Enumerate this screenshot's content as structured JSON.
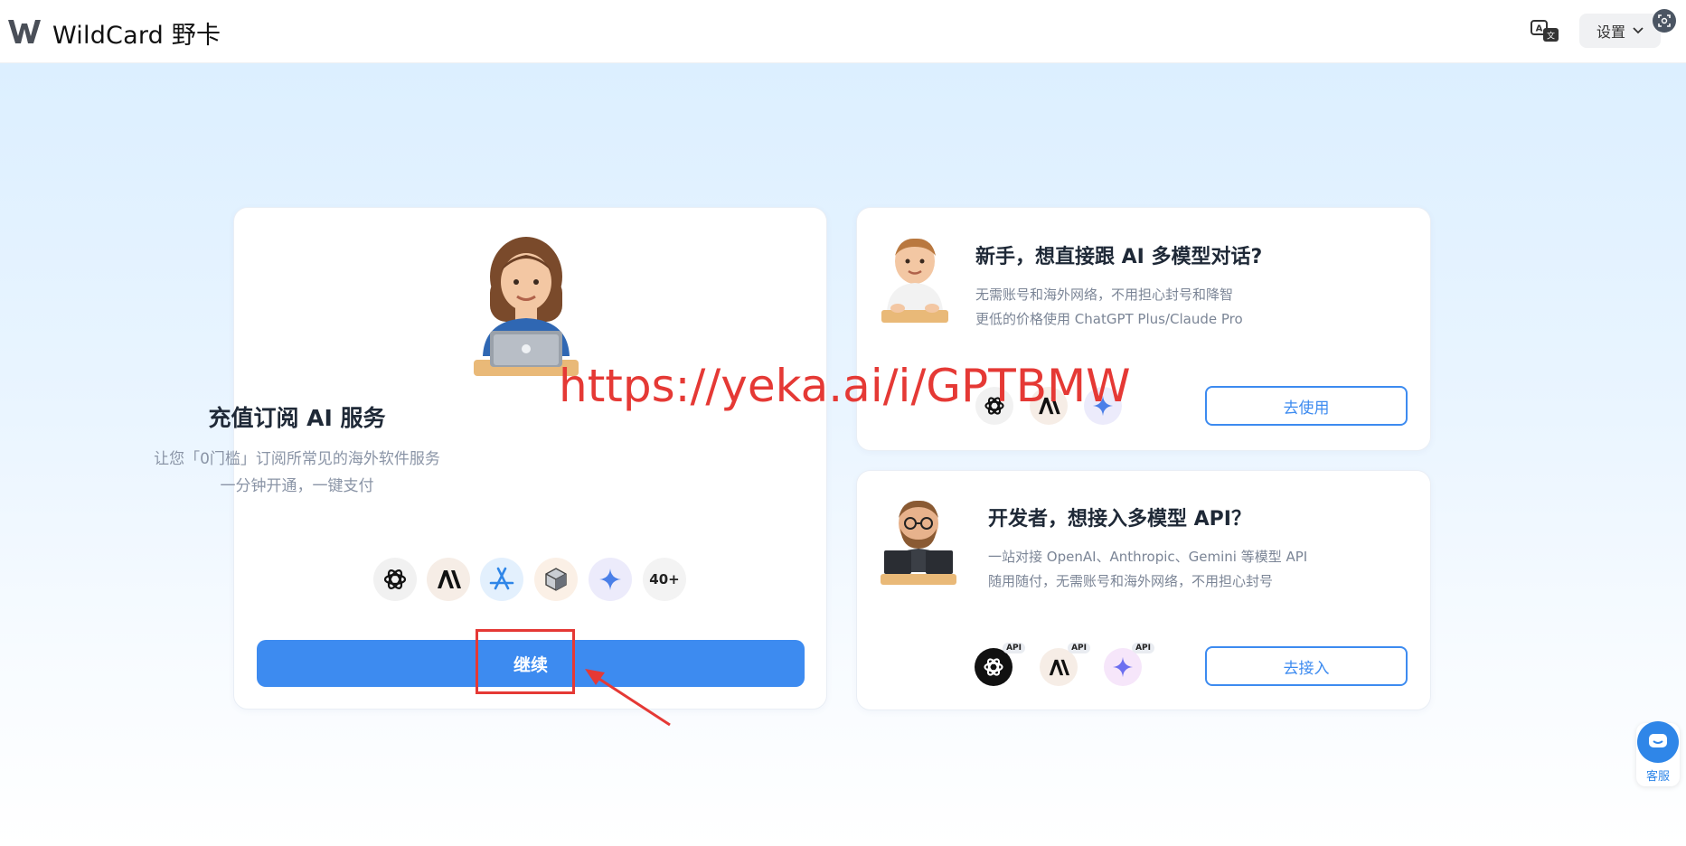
{
  "header": {
    "brand": "WildCard 野卡",
    "settings_label": "设置"
  },
  "main_card": {
    "title": "充值订阅 AI 服务",
    "subtitle_line1": "让您「0门槛」订阅所常见的海外软件服务",
    "subtitle_line2": "一分钟开通，一键支付",
    "services": [
      "openai-icon",
      "anthropic-icon",
      "app-store-icon",
      "box-icon",
      "gemini-icon",
      "40+"
    ],
    "continue_label": "继续"
  },
  "watermark": "https://yeka.ai/i/GPTBMW",
  "beginner_card": {
    "title": "新手，想直接跟 AI 多模型对话?",
    "desc_line1": "无需账号和海外网络，不用担心封号和降智",
    "desc_line2": "更低的价格使用 ChatGPT Plus/Claude Pro",
    "button_label": "去使用"
  },
  "developer_card": {
    "title": "开发者，想接入多模型 API？",
    "desc_line1": "一站对接 OpenAI、Anthropic、Gemini 等模型 API",
    "desc_line2": "随用随付，无需账号和海外网络，不用担心封号",
    "api_tag": "API",
    "button_label": "去接入"
  },
  "support": {
    "label": "客服"
  },
  "colors": {
    "accent": "#3d8bf0",
    "annotation_red": "#e53935"
  }
}
